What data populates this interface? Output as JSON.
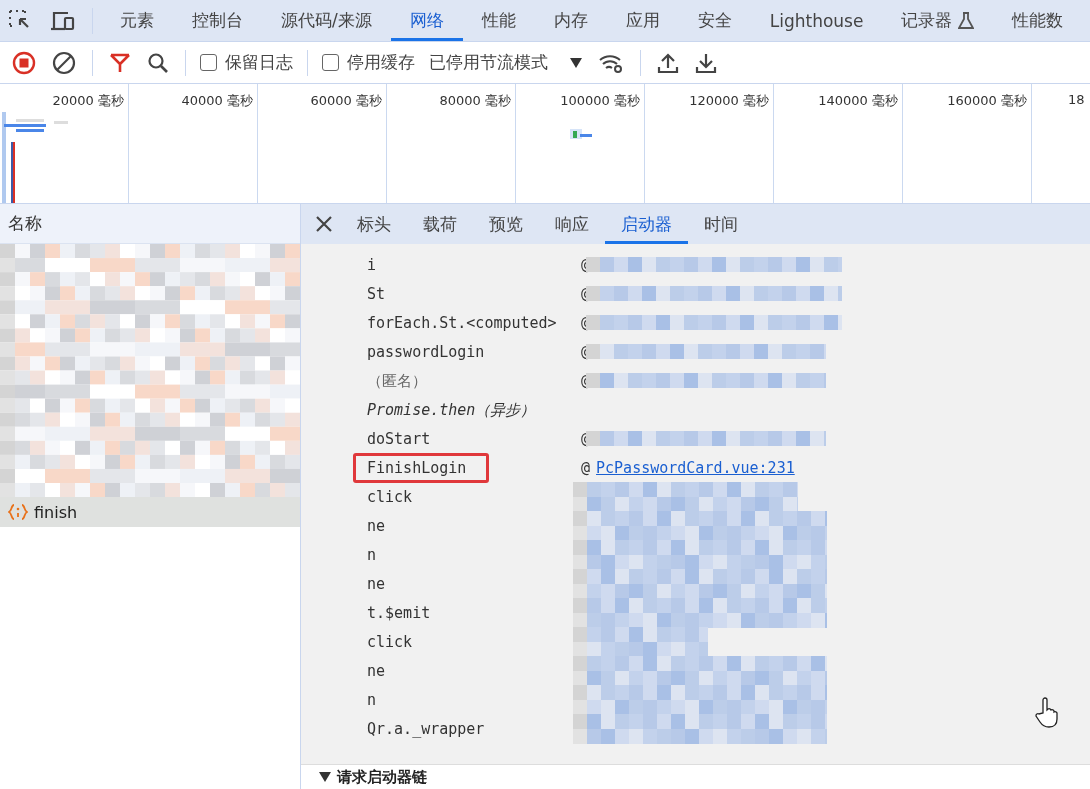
{
  "devtools_tabs": [
    {
      "label": "元素",
      "selected": false,
      "kind": "plain"
    },
    {
      "label": "控制台",
      "selected": false,
      "kind": "plain"
    },
    {
      "label": "源代码/来源",
      "selected": false,
      "kind": "plain"
    },
    {
      "label": "网络",
      "selected": true,
      "kind": "plain"
    },
    {
      "label": "性能",
      "selected": false,
      "kind": "plain"
    },
    {
      "label": "内存",
      "selected": false,
      "kind": "plain"
    },
    {
      "label": "应用",
      "selected": false,
      "kind": "plain"
    },
    {
      "label": "安全",
      "selected": false,
      "kind": "plain"
    },
    {
      "label": "Lighthouse",
      "selected": false,
      "kind": "plain"
    },
    {
      "label": "记录器",
      "selected": false,
      "kind": "experimental"
    },
    {
      "label": "性能数",
      "selected": false,
      "kind": "plain"
    }
  ],
  "toolbar": {
    "preserve_log": {
      "label": "保留日志",
      "checked": false
    },
    "disable_cache": {
      "label": "停用缓存",
      "checked": false
    },
    "throttling": "已停用节流模式"
  },
  "timeline": {
    "ticks": [
      "20000 毫秒",
      "40000 毫秒",
      "60000 毫秒",
      "80000 毫秒",
      "100000 毫秒",
      "120000 毫秒",
      "140000 毫秒",
      "160000 毫秒",
      "18"
    ]
  },
  "requests": {
    "header": "名称",
    "items": [
      {
        "name": "finish",
        "selected": true
      }
    ]
  },
  "detail_tabs": [
    {
      "label": "标头",
      "selected": false
    },
    {
      "label": "载荷",
      "selected": false
    },
    {
      "label": "预览",
      "selected": false
    },
    {
      "label": "响应",
      "selected": false
    },
    {
      "label": "启动器",
      "selected": true
    },
    {
      "label": "时间",
      "selected": false
    }
  ],
  "stack": [
    {
      "kind": "frame",
      "function": "i",
      "at": "@",
      "masked": true,
      "highlighted": false
    },
    {
      "kind": "frame",
      "function": "St",
      "at": "@",
      "masked": true,
      "highlighted": false
    },
    {
      "kind": "frame",
      "function": "forEach.St.<computed>",
      "at": "@",
      "masked": true,
      "highlighted": false
    },
    {
      "kind": "frame",
      "function": "passwordLogin",
      "at": "@",
      "masked": true,
      "highlighted": false
    },
    {
      "kind": "anonymous",
      "function": "（匿名）",
      "at": "@",
      "masked": true,
      "highlighted": false
    },
    {
      "kind": "async",
      "function": "Promise.then",
      "note": "（异步）"
    },
    {
      "kind": "frame",
      "function": "doStart",
      "at": "@",
      "masked": true,
      "highlighted": false
    },
    {
      "kind": "frame",
      "function": "FinishLogin",
      "at": "@",
      "location": "PcPasswordCard.vue:231",
      "masked": false,
      "highlighted": true
    },
    {
      "kind": "frame",
      "function": "click",
      "masked": true,
      "highlighted": false
    },
    {
      "kind": "frame",
      "function": "ne",
      "masked": true,
      "highlighted": false
    },
    {
      "kind": "frame",
      "function": "n",
      "masked": true,
      "highlighted": false
    },
    {
      "kind": "frame",
      "function": "ne",
      "masked": true,
      "highlighted": false
    },
    {
      "kind": "frame",
      "function": "t.$emit",
      "masked": true,
      "highlighted": false
    },
    {
      "kind": "frame",
      "function": "click",
      "masked": true,
      "highlighted": false
    },
    {
      "kind": "frame",
      "function": "ne",
      "masked": true,
      "highlighted": false
    },
    {
      "kind": "frame",
      "function": "n",
      "masked": true,
      "highlighted": false
    },
    {
      "kind": "frame",
      "function": "Qr.a._wrapper",
      "masked": true,
      "highlighted": false
    }
  ],
  "section": {
    "label": "请求启动器链",
    "expanded": true
  }
}
